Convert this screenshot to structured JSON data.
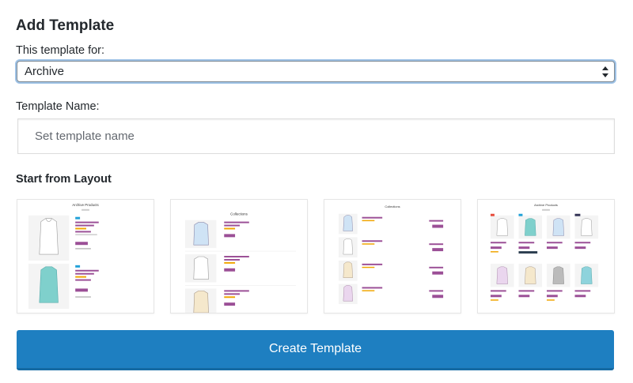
{
  "header": {
    "title": "Add Template"
  },
  "form": {
    "type_label": "This template for:",
    "type_value": "Archive",
    "name_label": "Template Name:",
    "name_placeholder": "Set template name",
    "layout_label": "Start from Layout"
  },
  "layouts": [
    {
      "heading": "Archive Products"
    },
    {
      "heading": "Collections"
    },
    {
      "heading": "Collections"
    },
    {
      "heading": "Archive Products"
    }
  ],
  "colors": {
    "accent": "#1e7fc1",
    "purple": "#9b4f96",
    "teal": "#7fd0cc"
  },
  "actions": {
    "create_label": "Create Template"
  }
}
